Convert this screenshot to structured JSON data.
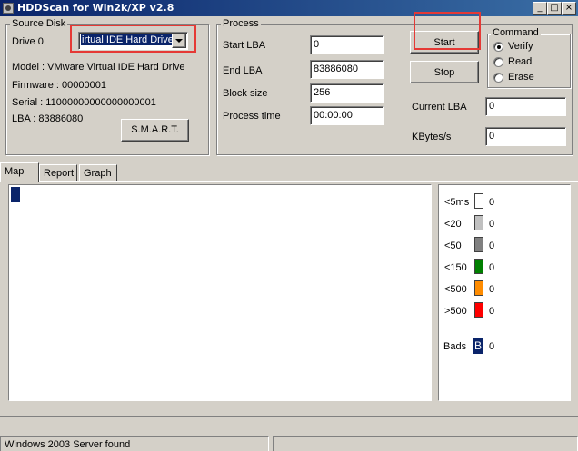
{
  "window": {
    "title": "HDDScan for Win2k/XP  v2.8",
    "min_glyph": "_",
    "max_glyph": "□",
    "close_glyph": "×"
  },
  "source": {
    "title": "Source Disk",
    "drive_label": "Drive  0",
    "drive_value": "irtual IDE Hard Drive",
    "model": "Model : VMware Virtual IDE Hard Drive",
    "firmware": "Firmware : 00000001",
    "serial": "Serial : 11000000000000000001",
    "lba": "LBA :  83886080",
    "smart_label": "S.M.A.R.T."
  },
  "process": {
    "title": "Process",
    "start_lba_label": "Start LBA",
    "start_lba": "0",
    "end_lba_label": "End LBA",
    "end_lba": "83886080",
    "block_size_label": "Block size",
    "block_size": "256",
    "process_time_label": "Process time",
    "process_time": "00:00:00",
    "start_label": "Start",
    "stop_label": "Stop",
    "current_lba_label": "Current LBA",
    "current_lba": "0",
    "kbytes_label": "KBytes/s",
    "kbytes": "0"
  },
  "command": {
    "title": "Command",
    "options": [
      "Verify",
      "Read",
      "Erase"
    ],
    "selected": "Verify"
  },
  "tabs": [
    "Map",
    "Report",
    "Graph"
  ],
  "active_tab": "Map",
  "legend": [
    {
      "label": "<5ms",
      "count": "0",
      "color": "#ffffff"
    },
    {
      "label": "<20",
      "count": "0",
      "color": "#c0c0c0"
    },
    {
      "label": "<50",
      "count": "0",
      "color": "#808080"
    },
    {
      "label": "<150",
      "count": "0",
      "color": "#008000"
    },
    {
      "label": "<500",
      "count": "0",
      "color": "#ff8c00"
    },
    {
      "label": ">500",
      "count": "0",
      "color": "#ff0000"
    }
  ],
  "bads": {
    "label": "Bads",
    "glyph": "B",
    "count": "0",
    "color": "#0a246a"
  },
  "status": {
    "text": "Windows 2003 Server found"
  },
  "colors": {
    "titlebar": "#0a246a",
    "highlight": "#e53935",
    "map_block": "#0a246a"
  }
}
